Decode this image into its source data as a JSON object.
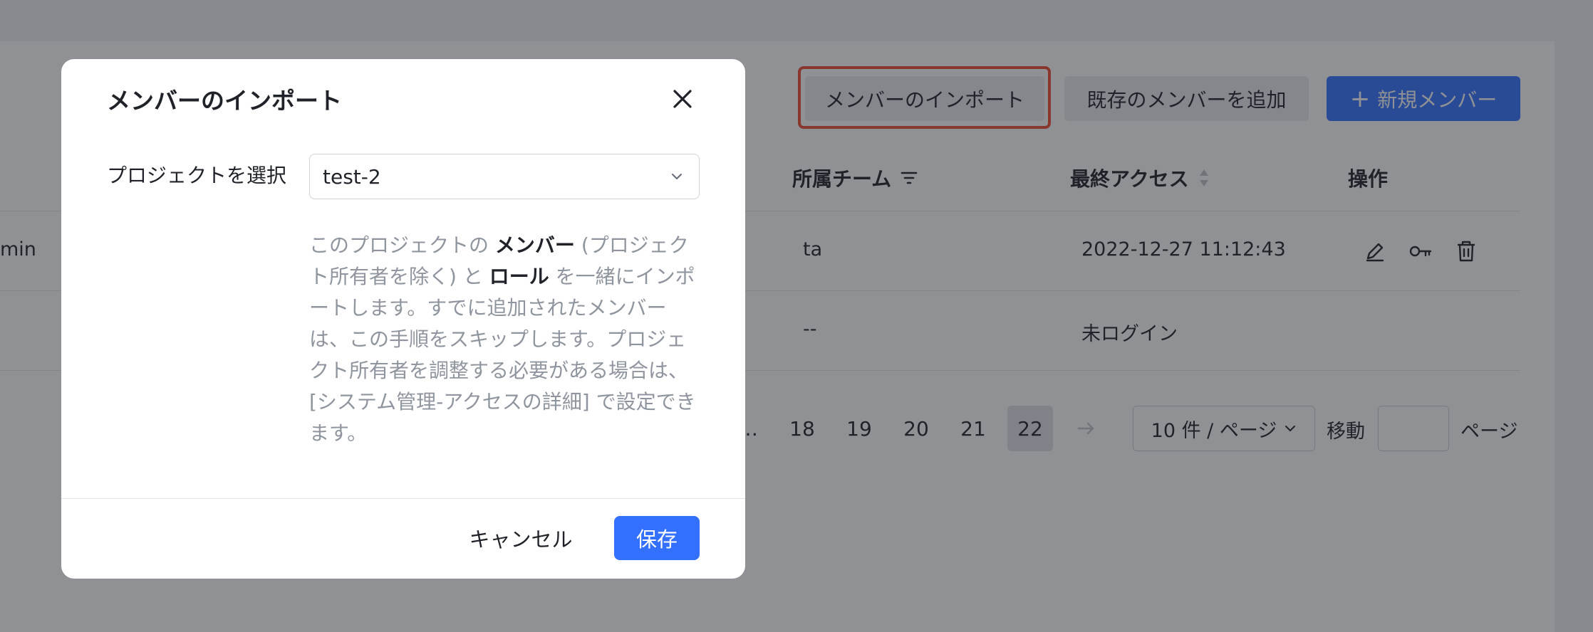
{
  "toolbar": {
    "import_label": "メンバーのインポート",
    "add_existing_label": "既存のメンバーを追加",
    "new_member_label": "新規メンバー"
  },
  "table": {
    "headers": {
      "team": "所属チーム",
      "last_access": "最終アクセス",
      "actions": "操作"
    },
    "rows": [
      {
        "partial_name": "min",
        "team": "ta",
        "last_access": "2022-12-27 11:12:43"
      },
      {
        "partial_name": "",
        "team": "--",
        "last_access": "未ログイン"
      }
    ]
  },
  "pagination": {
    "ellipsis": "…",
    "pages": [
      "18",
      "19",
      "20",
      "21",
      "22"
    ],
    "current": "22",
    "page_size": "10 件 / ページ",
    "jump_label": "移動",
    "page_suffix": "ページ"
  },
  "modal": {
    "title": "メンバーのインポート",
    "project_label": "プロジェクトを選択",
    "project_value": "test-2",
    "hint": {
      "p1": "このプロジェクトの ",
      "b1": "メンバー",
      "p2": " (プロジェクト所有者を除く) と ",
      "b2": "ロール",
      "p3": " を一緒にインポートします。すでに追加されたメンバーは、この手順をスキップします。プロジェクト所有者を調整する必要がある場合は、[システム管理-アクセスの詳細] で設定できます。"
    },
    "cancel_label": "キャンセル",
    "save_label": "保存"
  },
  "colors": {
    "primary": "#3370ff",
    "highlight": "#f04a2e",
    "mask": "rgba(31,35,41,0.5)"
  }
}
